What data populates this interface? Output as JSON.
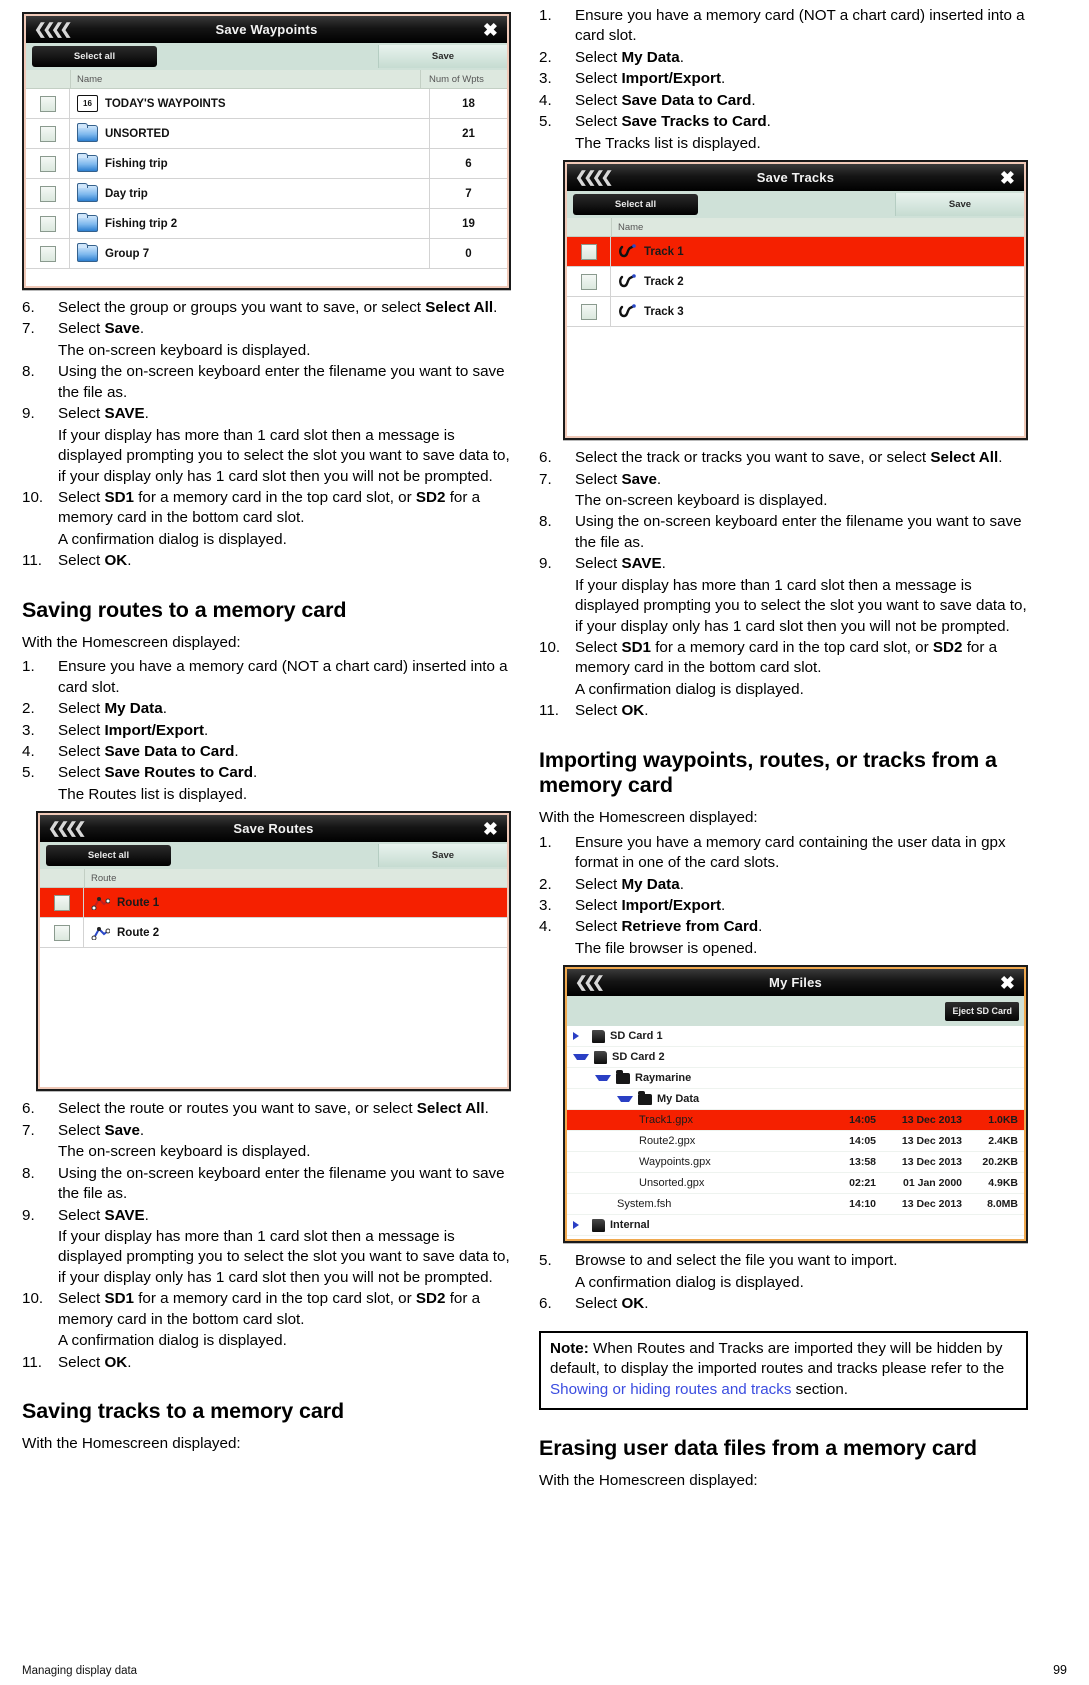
{
  "footer": {
    "left": "Managing display data",
    "page": "99"
  },
  "waypoints_shot": {
    "title": "Save Waypoints",
    "back_icon": "back-chevrons-icon",
    "close_icon": "close-icon",
    "select_all": "Select all",
    "save": "Save",
    "col_name": "Name",
    "col_num": "Num of Wpts",
    "rows": [
      {
        "icon": "calendar-icon",
        "badge": "16",
        "name": "TODAY'S WAYPOINTS",
        "count": "18",
        "selected": false
      },
      {
        "icon": "folder-icon",
        "name": "UNSORTED",
        "count": "21",
        "selected": false
      },
      {
        "icon": "folder-icon",
        "name": "Fishing trip",
        "count": "6",
        "selected": false
      },
      {
        "icon": "folder-icon",
        "name": "Day trip",
        "count": "7",
        "selected": false
      },
      {
        "icon": "folder-icon",
        "name": "Fishing trip 2",
        "count": "19",
        "selected": false
      },
      {
        "icon": "folder-icon",
        "name": "Group 7",
        "count": "0",
        "selected": false
      }
    ]
  },
  "routes_shot": {
    "title": "Save Routes",
    "select_all": "Select all",
    "save": "Save",
    "col_name": "Route",
    "rows": [
      {
        "icon": "route-icon",
        "name": "Route 1",
        "selected": true
      },
      {
        "icon": "route-icon",
        "name": "Route 2",
        "selected": false
      }
    ]
  },
  "tracks_shot": {
    "title": "Save Tracks",
    "select_all": "Select all",
    "save": "Save",
    "col_name": "Name",
    "rows": [
      {
        "icon": "track-icon",
        "name": "Track 1",
        "selected": true
      },
      {
        "icon": "track-icon",
        "name": "Track 2",
        "selected": false
      },
      {
        "icon": "track-icon",
        "name": "Track 3",
        "selected": false
      }
    ]
  },
  "files_shot": {
    "title": "My Files",
    "eject": "Eject SD Card",
    "rows": [
      {
        "indent": 0,
        "twisty": "right",
        "icon": "sd-card-icon",
        "name": "SD Card 1",
        "time": "",
        "date": "",
        "size": "",
        "selected": false
      },
      {
        "indent": 0,
        "twisty": "down",
        "icon": "sd-card-icon",
        "name": "SD Card 2",
        "time": "",
        "date": "",
        "size": "",
        "selected": false
      },
      {
        "indent": 1,
        "twisty": "down",
        "icon": "folder-icon",
        "name": "Raymarine",
        "time": "",
        "date": "",
        "size": "",
        "selected": false
      },
      {
        "indent": 2,
        "twisty": "down",
        "icon": "folder-icon",
        "name": "My Data",
        "time": "",
        "date": "",
        "size": "",
        "selected": false
      },
      {
        "indent": 3,
        "twisty": "none",
        "icon": "file-icon",
        "name": "Track1.gpx",
        "time": "14:05",
        "date": "13 Dec 2013",
        "size": "1.0KB",
        "selected": true
      },
      {
        "indent": 3,
        "twisty": "none",
        "icon": "file-icon",
        "name": "Route2.gpx",
        "time": "14:05",
        "date": "13 Dec 2013",
        "size": "2.4KB",
        "selected": false
      },
      {
        "indent": 3,
        "twisty": "none",
        "icon": "file-icon",
        "name": "Waypoints.gpx",
        "time": "13:58",
        "date": "13 Dec 2013",
        "size": "20.2KB",
        "selected": false
      },
      {
        "indent": 3,
        "twisty": "none",
        "icon": "file-icon",
        "name": "Unsorted.gpx",
        "time": "02:21",
        "date": "01 Jan 2000",
        "size": "4.9KB",
        "selected": false
      },
      {
        "indent": 2,
        "twisty": "none",
        "icon": "file-icon",
        "name": "System.fsh",
        "time": "14:10",
        "date": "13 Dec 2013",
        "size": "8.0MB",
        "selected": false
      },
      {
        "indent": 0,
        "twisty": "right",
        "icon": "sd-card-icon",
        "name": "Internal",
        "time": "",
        "date": "",
        "size": "",
        "selected": false
      }
    ]
  },
  "waypoints_steps": {
    "s6_a": "Select the group or groups you want to save, or select ",
    "s6_b": "Select All",
    "s6_c": ".",
    "s7_a": "Select ",
    "s7_b": "Save",
    "s7_c": ".",
    "s7_note": "The on-screen keyboard is displayed.",
    "s8": "Using the on-screen keyboard enter the filename you want to save the file as.",
    "s9_a": "Select ",
    "s9_b": "SAVE",
    "s9_c": ".",
    "s9_note": "If your display has more than 1 card slot then a message is displayed prompting you to select the slot you want to save data to, if your display only has 1 card slot then you will not be prompted.",
    "s10_a": "Select ",
    "s10_b": "SD1",
    "s10_c": " for a memory card in the top card slot, or ",
    "s10_d": "SD2",
    "s10_e": " for a memory card in the bottom card slot.",
    "s10_note": "A confirmation dialog is displayed.",
    "s11_a": "Select ",
    "s11_b": "OK",
    "s11_c": ".",
    "n6": "6.",
    "n7": "7.",
    "n8": "8.",
    "n9": "9.",
    "n10": "10.",
    "n11": "11."
  },
  "routes_section": {
    "heading": "Saving routes to a memory card",
    "lead": "With the Homescreen displayed:",
    "n1": "1.",
    "n2": "2.",
    "n3": "3.",
    "n4": "4.",
    "n5": "5.",
    "s1": "Ensure you have a memory card (NOT a chart card) inserted into a card slot.",
    "s2_a": "Select ",
    "s2_b": "My Data",
    "s2_c": ".",
    "s3_a": "Select ",
    "s3_b": "Import/Export",
    "s3_c": ".",
    "s4_a": "Select ",
    "s4_b": "Save Data to Card",
    "s4_c": ".",
    "s5_a": "Select ",
    "s5_b": "Save Routes to Card",
    "s5_c": ".",
    "s5_note": "The Routes list is displayed.",
    "s6_a": "Select the route or routes you want to save, or select ",
    "s6_b": "Select All",
    "s6_c": "."
  },
  "tracks_section": {
    "heading": "Saving tracks to a memory card",
    "lead": "With the Homescreen displayed:",
    "n1": "1.",
    "n2": "2.",
    "n3": "3.",
    "n4": "4.",
    "n5": "5.",
    "s1": "Ensure you have a memory card (NOT a chart card) inserted into a card slot.",
    "s2_a": "Select ",
    "s2_b": "My Data",
    "s2_c": ".",
    "s3_a": "Select ",
    "s3_b": "Import/Export",
    "s3_c": ".",
    "s4_a": "Select ",
    "s4_b": "Save Data to Card",
    "s4_c": ".",
    "s5_a": "Select ",
    "s5_b": "Save Tracks to Card",
    "s5_c": ".",
    "s5_note": "The Tracks list is displayed.",
    "s6_a": "Select the track or tracks you want to save, or select ",
    "s6_b": "Select All",
    "s6_c": "."
  },
  "importing_section": {
    "heading": "Importing waypoints, routes, or tracks from a memory card",
    "lead": "With the Homescreen displayed:",
    "n1": "1.",
    "n2": "2.",
    "n3": "3.",
    "n4": "4.",
    "n5": "5.",
    "n6": "6.",
    "s1": "Ensure you have a memory card containing the user data in gpx format in one of the card slots.",
    "s2_a": "Select ",
    "s2_b": "My Data",
    "s2_c": ".",
    "s3_a": "Select ",
    "s3_b": "Import/Export",
    "s3_c": ".",
    "s4_a": "Select ",
    "s4_b": "Retrieve from Card",
    "s4_c": ".",
    "s4_note": "The file browser is opened.",
    "s5": "Browse to and select the file you want to import.",
    "s5_note": "A confirmation dialog is displayed.",
    "s6_a": "Select ",
    "s6_b": "OK",
    "s6_c": ".",
    "note_label": "Note:",
    "note_p1": " When Routes and Tracks are imported they will be hidden by default, to display the imported routes and tracks please refer to the ",
    "note_link": "Showing or hiding routes and tracks",
    "note_p2": " section."
  },
  "erasing_section": {
    "heading": "Erasing user data files from a memory card",
    "lead": "With the Homescreen displayed:"
  }
}
